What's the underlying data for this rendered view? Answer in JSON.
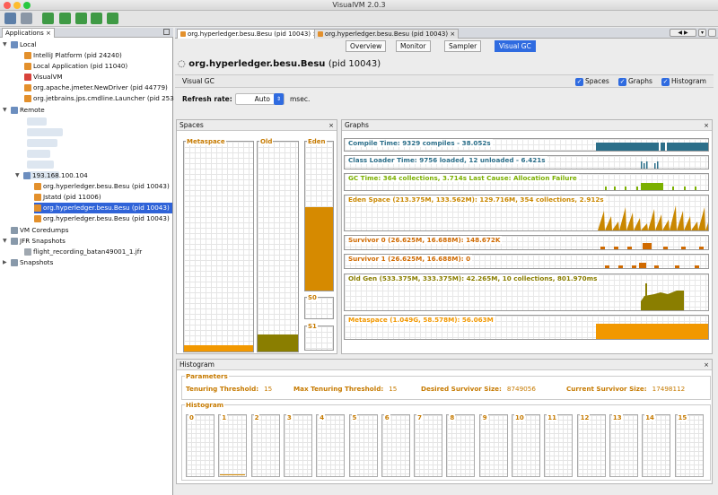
{
  "window": {
    "title": "VisualVM 2.0.3"
  },
  "left": {
    "tab_label": "Applications",
    "close": "×",
    "local_label": "Local",
    "local_items": [
      "IntelliJ Platform (pid 24240)",
      "Local Application (pid 11040)",
      "VisualVM",
      "org.apache.jmeter.NewDriver (pid 44779)",
      "org.jetbrains.jps.cmdline.Launcher (pid 253"
    ],
    "remote_label": "Remote",
    "host_label": "193.168.100.104",
    "host_items": [
      "org.hyperledger.besu.Besu (pid 10043)",
      "Jstatd (pid 11006)",
      "org.hyperledger.besu.Besu (pid 10043)",
      "org.hyperledger.besu.Besu (pid 10043)"
    ],
    "coredumps_label": "VM Coredumps",
    "jfr_label": "JFR Snapshots",
    "jfr_item": "flight_recording_batan49001_1.jfr",
    "snapshots_label": "Snapshots"
  },
  "doc_tabs": [
    "org.hyperledger.besu.Besu (pid 10043)",
    "org.hyperledger.besu.Besu (pid 10043)"
  ],
  "sub_tabs": [
    "Overview",
    "Monitor",
    "Sampler",
    "Visual GC"
  ],
  "app": {
    "name": "org.hyperledger.besu.Besu",
    "pid": "(pid 10043)"
  },
  "visualgc": {
    "label": "Visual GC",
    "checks": [
      "Spaces",
      "Graphs",
      "Histogram"
    ],
    "refresh_label": "Refresh rate:",
    "refresh_value": "Auto",
    "refresh_unit": "msec."
  },
  "spaces": {
    "title": "Spaces",
    "columns": [
      {
        "name": "Metaspace",
        "fill": 0.03,
        "color": "#f29800"
      },
      {
        "name": "Old",
        "fill": 0.08,
        "color": "#8a7e00"
      },
      {
        "name": "Eden",
        "fill": 0.56,
        "color": "#d68a00"
      },
      {
        "name": "S0",
        "fill": 0.0,
        "color": "#d68a00"
      },
      {
        "name": "S1",
        "fill": 0.0,
        "color": "#d68a00"
      }
    ]
  },
  "graphs": {
    "title": "Graphs",
    "rows": [
      {
        "label": "Compile Time: 9329 compiles - 38.052s",
        "color": "#2c6f8a"
      },
      {
        "label": "Class Loader Time: 9756 loaded, 12 unloaded - 6.421s",
        "color": "#2c6f8a"
      },
      {
        "label": "GC Time: 364 collections, 3.714s  Last Cause: Allocation Failure",
        "color": "#7bb000"
      },
      {
        "label": "Eden Space (213.375M, 133.562M): 129.716M, 354 collections, 2.912s",
        "color": "#c98700"
      },
      {
        "label": "Survivor 0 (26.625M, 16.688M): 148.672K",
        "color": "#d06a00"
      },
      {
        "label": "Survivor 1 (26.625M, 16.688M): 0",
        "color": "#d06a00"
      },
      {
        "label": "Old Gen (533.375M, 333.375M): 42.265M, 10 collections, 801.970ms",
        "color": "#8a7e00"
      },
      {
        "label": "Metaspace (1.049G, 58.578M): 56.063M",
        "color": "#f29800"
      }
    ]
  },
  "histogram": {
    "title": "Histogram",
    "params_title": "Parameters",
    "params": [
      {
        "label": "Tenuring Threshold:",
        "value": "15"
      },
      {
        "label": "Max Tenuring Threshold:",
        "value": "15"
      },
      {
        "label": "Desired Survivor Size:",
        "value": "8749056"
      },
      {
        "label": "Current Survivor Size:",
        "value": "17498112"
      }
    ],
    "hist_title": "Histogram",
    "bins": [
      "0",
      "1",
      "2",
      "3",
      "4",
      "5",
      "6",
      "7",
      "8",
      "9",
      "10",
      "11",
      "12",
      "13",
      "14",
      "15"
    ]
  }
}
